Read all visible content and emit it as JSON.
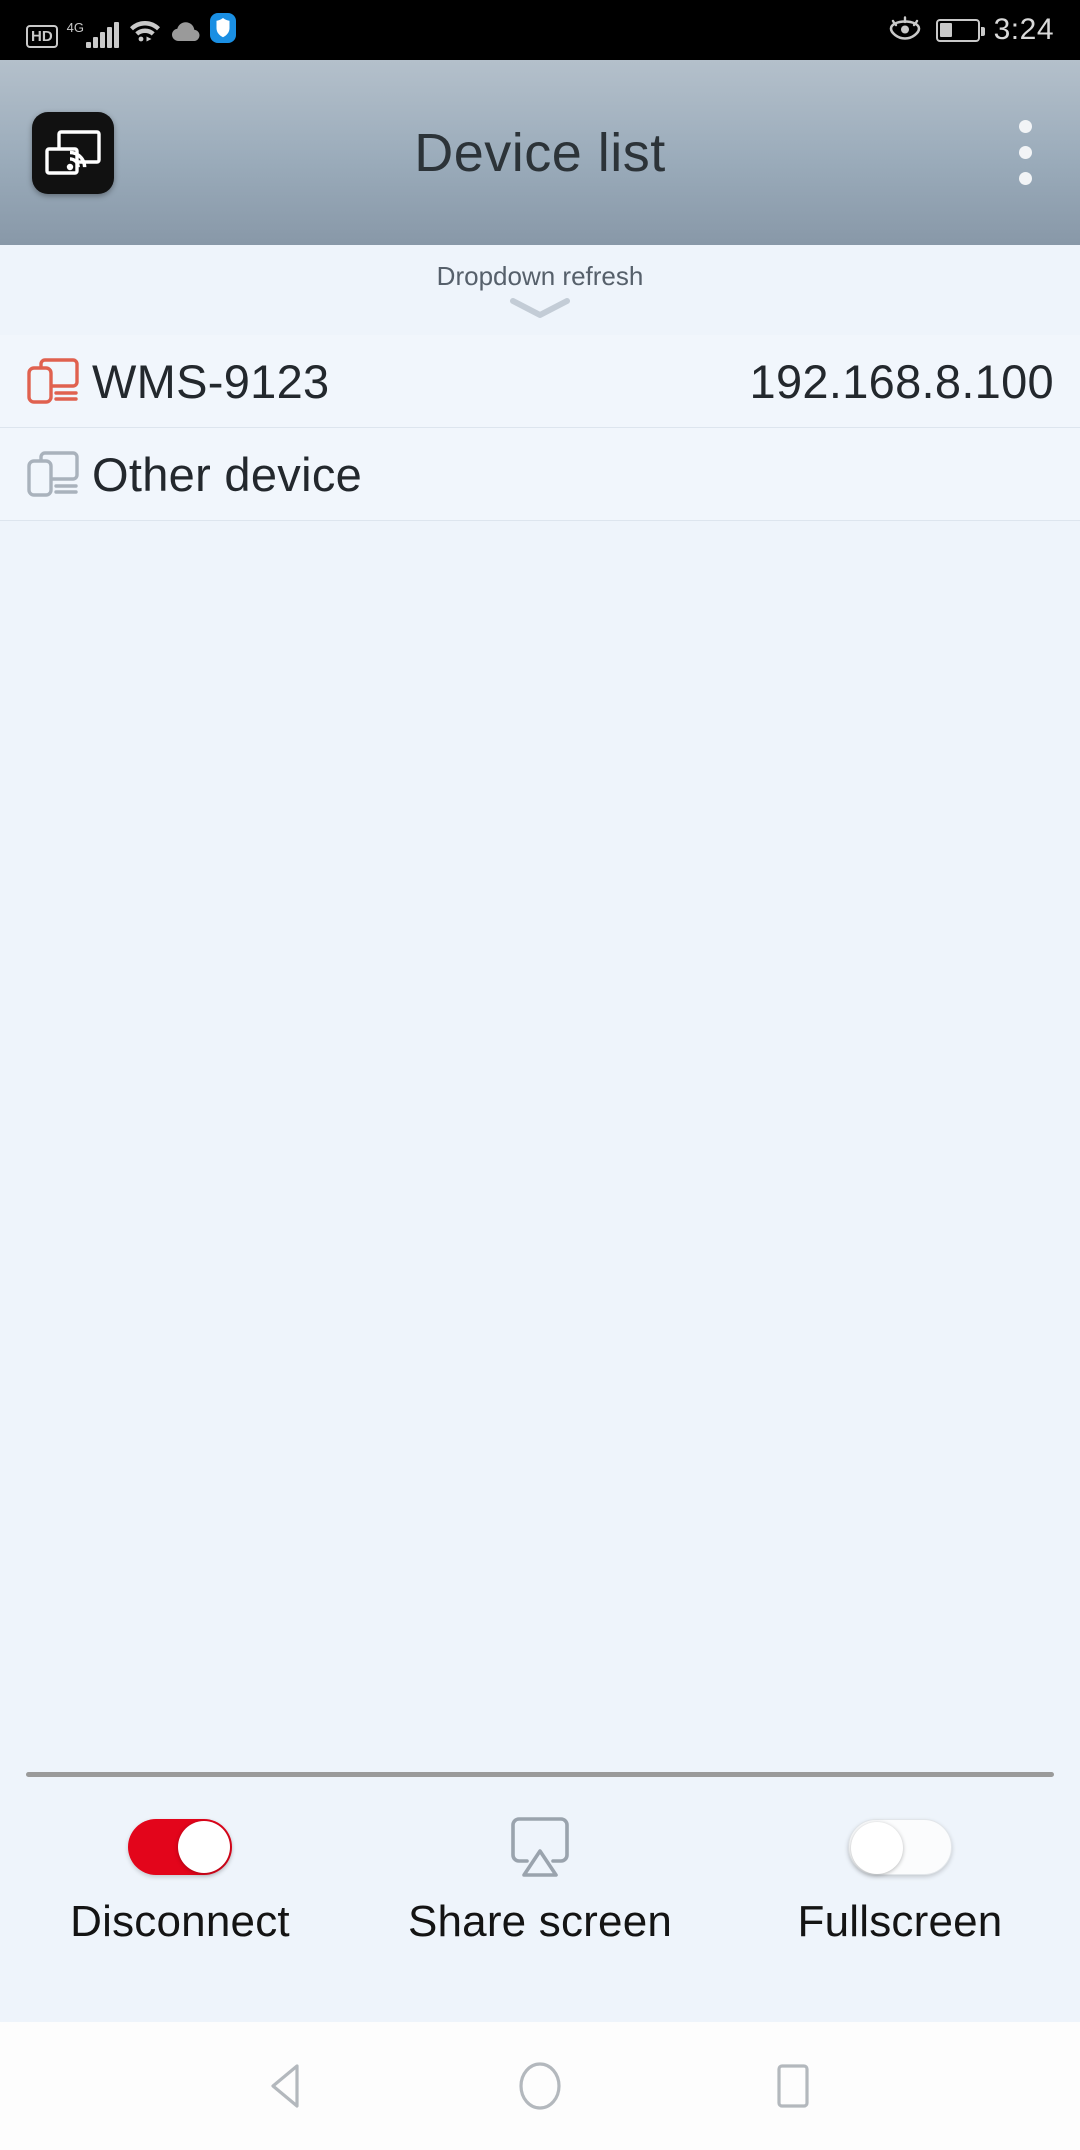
{
  "status_bar": {
    "hd_badge": "HD",
    "network_type": "4G",
    "signal_icon": "signal-bars-icon",
    "wifi_icon": "wifi-icon",
    "cloud_icon": "cloud-icon",
    "shield_icon": "shield-icon",
    "eye_comfort_icon": "eye-comfort-icon",
    "battery_icon": "battery-icon",
    "battery_level_percent": 35,
    "time": "3:24",
    "background_color": "#000000"
  },
  "app_bar": {
    "app_icon": "screen-cast-icon",
    "title": "Device list",
    "overflow_icon": "more-vertical-icon",
    "background_color": "#9aabba",
    "title_color": "#2c3338"
  },
  "refresh": {
    "label": "Dropdown refresh",
    "chevron_icon": "chevron-down-icon"
  },
  "device_list": {
    "rows": [
      {
        "icon": "cast-device-icon",
        "icon_color": "#e0614f",
        "name": "WMS-9123",
        "ip": "192.168.8.100",
        "connected": true
      },
      {
        "icon": "cast-device-icon",
        "icon_color": "#a9b2bc",
        "name": "Other device",
        "ip": "",
        "connected": false
      }
    ]
  },
  "bottom_bar": {
    "items": [
      {
        "label": "Disconnect",
        "control": "toggle",
        "state": "on",
        "color": "#e3051b"
      },
      {
        "label": "Share screen",
        "control": "icon",
        "icon": "airplay-share-icon"
      },
      {
        "label": "Fullscreen",
        "control": "toggle",
        "state": "off",
        "color": "#ffffff"
      }
    ]
  },
  "nav_bar": {
    "back": "back-triangle-icon",
    "home": "home-circle-icon",
    "recents": "recents-square-icon"
  }
}
